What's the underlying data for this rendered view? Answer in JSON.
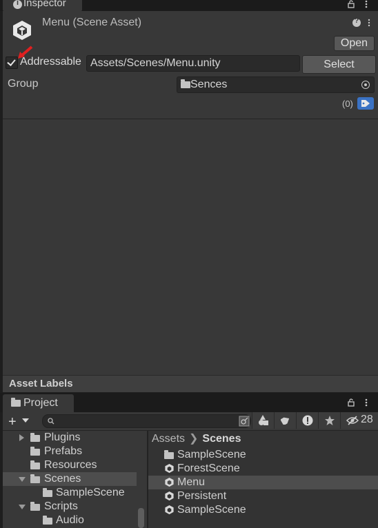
{
  "inspector": {
    "tab_label": "Inspector",
    "title": "Menu (Scene Asset)",
    "open_label": "Open",
    "addressable_label": "Addressable",
    "addressable_checked": true,
    "asset_path": "Assets/Scenes/Menu.unity",
    "select_label": "Select",
    "group_label": "Group",
    "group_value": "Sences",
    "labels_count": "(0)",
    "asset_labels_title": "Asset Labels"
  },
  "project": {
    "tab_label": "Project",
    "search_value": "",
    "hidden_count": "28",
    "tree": [
      {
        "label": "Plugins",
        "expanded": false,
        "has_children": true
      },
      {
        "label": "Prefabs",
        "expanded": false,
        "has_children": false
      },
      {
        "label": "Resources",
        "expanded": false,
        "has_children": false
      },
      {
        "label": "Scenes",
        "expanded": true,
        "has_children": true,
        "selected": true
      },
      {
        "label": "SampleScene",
        "expanded": false,
        "has_children": false
      },
      {
        "label": "Scripts",
        "expanded": true,
        "has_children": true
      },
      {
        "label": "Audio",
        "expanded": false,
        "has_children": false
      }
    ],
    "breadcrumb": [
      "Assets",
      "Scenes"
    ],
    "items": [
      {
        "label": "SampleScene",
        "type": "folder"
      },
      {
        "label": "ForestScene",
        "type": "scene"
      },
      {
        "label": "Menu",
        "type": "scene",
        "selected": true
      },
      {
        "label": "Persistent",
        "type": "scene"
      },
      {
        "label": "SampleScene",
        "type": "scene"
      }
    ]
  },
  "colors": {
    "panel": "#383838",
    "accent_tag": "#3a72c4",
    "annotation_arrow": "#e02020"
  }
}
